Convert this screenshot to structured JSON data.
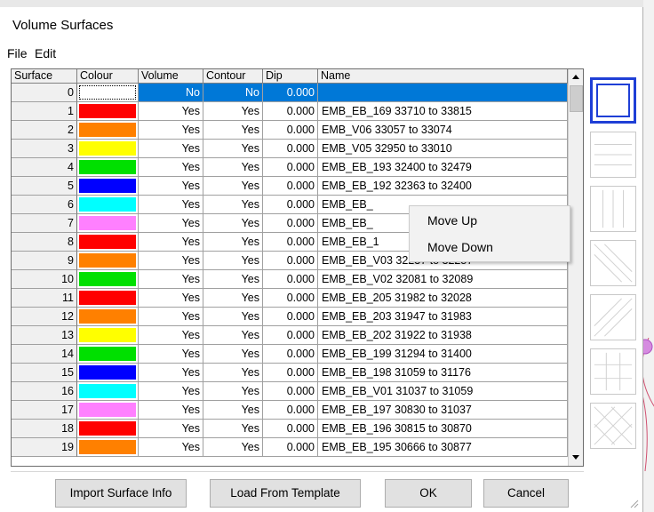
{
  "window": {
    "title": "Volume Surfaces"
  },
  "menu": {
    "file": "File",
    "edit": "Edit"
  },
  "columns": {
    "surface": "Surface",
    "colour": "Colour",
    "volume": "Volume",
    "contour": "Contour",
    "dip": "Dip",
    "name": "Name"
  },
  "rows": [
    {
      "surface": "0",
      "colour": "#ffffff",
      "volume": "No",
      "contour": "No",
      "dip": "0.000",
      "name": ""
    },
    {
      "surface": "1",
      "colour": "#ff0000",
      "volume": "Yes",
      "contour": "Yes",
      "dip": "0.000",
      "name": "EMB_EB_169 33710 to 33815"
    },
    {
      "surface": "2",
      "colour": "#ff8000",
      "volume": "Yes",
      "contour": "Yes",
      "dip": "0.000",
      "name": "EMB_V06 33057 to 33074"
    },
    {
      "surface": "3",
      "colour": "#ffff00",
      "volume": "Yes",
      "contour": "Yes",
      "dip": "0.000",
      "name": "EMB_V05 32950 to 33010"
    },
    {
      "surface": "4",
      "colour": "#00e000",
      "volume": "Yes",
      "contour": "Yes",
      "dip": "0.000",
      "name": "EMB_EB_193 32400 to 32479"
    },
    {
      "surface": "5",
      "colour": "#0000ff",
      "volume": "Yes",
      "contour": "Yes",
      "dip": "0.000",
      "name": "EMB_EB_192 32363 to 32400"
    },
    {
      "surface": "6",
      "colour": "#00ffff",
      "volume": "Yes",
      "contour": "Yes",
      "dip": "0.000",
      "name": "EMB_EB_"
    },
    {
      "surface": "7",
      "colour": "#ff80ff",
      "volume": "Yes",
      "contour": "Yes",
      "dip": "0.000",
      "name": "EMB_EB_"
    },
    {
      "surface": "8",
      "colour": "#ff0000",
      "volume": "Yes",
      "contour": "Yes",
      "dip": "0.000",
      "name": "EMB_EB_1"
    },
    {
      "surface": "9",
      "colour": "#ff8000",
      "volume": "Yes",
      "contour": "Yes",
      "dip": "0.000",
      "name": "EMB_EB_V03 32237 to 32257"
    },
    {
      "surface": "10",
      "colour": "#00e000",
      "volume": "Yes",
      "contour": "Yes",
      "dip": "0.000",
      "name": "EMB_EB_V02 32081 to 32089"
    },
    {
      "surface": "11",
      "colour": "#ff0000",
      "volume": "Yes",
      "contour": "Yes",
      "dip": "0.000",
      "name": "EMB_EB_205 31982 to 32028"
    },
    {
      "surface": "12",
      "colour": "#ff8000",
      "volume": "Yes",
      "contour": "Yes",
      "dip": "0.000",
      "name": "EMB_EB_203 31947 to 31983"
    },
    {
      "surface": "13",
      "colour": "#ffff00",
      "volume": "Yes",
      "contour": "Yes",
      "dip": "0.000",
      "name": "EMB_EB_202 31922 to 31938"
    },
    {
      "surface": "14",
      "colour": "#00e000",
      "volume": "Yes",
      "contour": "Yes",
      "dip": "0.000",
      "name": "EMB_EB_199 31294 to 31400"
    },
    {
      "surface": "15",
      "colour": "#0000ff",
      "volume": "Yes",
      "contour": "Yes",
      "dip": "0.000",
      "name": "EMB_EB_198 31059 to 31176"
    },
    {
      "surface": "16",
      "colour": "#00ffff",
      "volume": "Yes",
      "contour": "Yes",
      "dip": "0.000",
      "name": "EMB_EB_V01 31037 to 31059"
    },
    {
      "surface": "17",
      "colour": "#ff80ff",
      "volume": "Yes",
      "contour": "Yes",
      "dip": "0.000",
      "name": "EMB_EB_197 30830 to 31037"
    },
    {
      "surface": "18",
      "colour": "#ff0000",
      "volume": "Yes",
      "contour": "Yes",
      "dip": "0.000",
      "name": "EMB_EB_196 30815 to 30870"
    },
    {
      "surface": "19",
      "colour": "#ff8000",
      "volume": "Yes",
      "contour": "Yes",
      "dip": "0.000",
      "name": "EMB_EB_195 30666 to 30877"
    }
  ],
  "context_menu": {
    "move_up": "Move Up",
    "move_down": "Move Down"
  },
  "buttons": {
    "import": "Import Surface Info",
    "load": "Load From Template",
    "ok": "OK",
    "cancel": "Cancel"
  },
  "fill_patterns": [
    "solid-outline",
    "horizontal-lines",
    "vertical-lines",
    "diagonal-down",
    "diagonal-up",
    "grid",
    "crosshatch"
  ],
  "accent": "#0078d7"
}
